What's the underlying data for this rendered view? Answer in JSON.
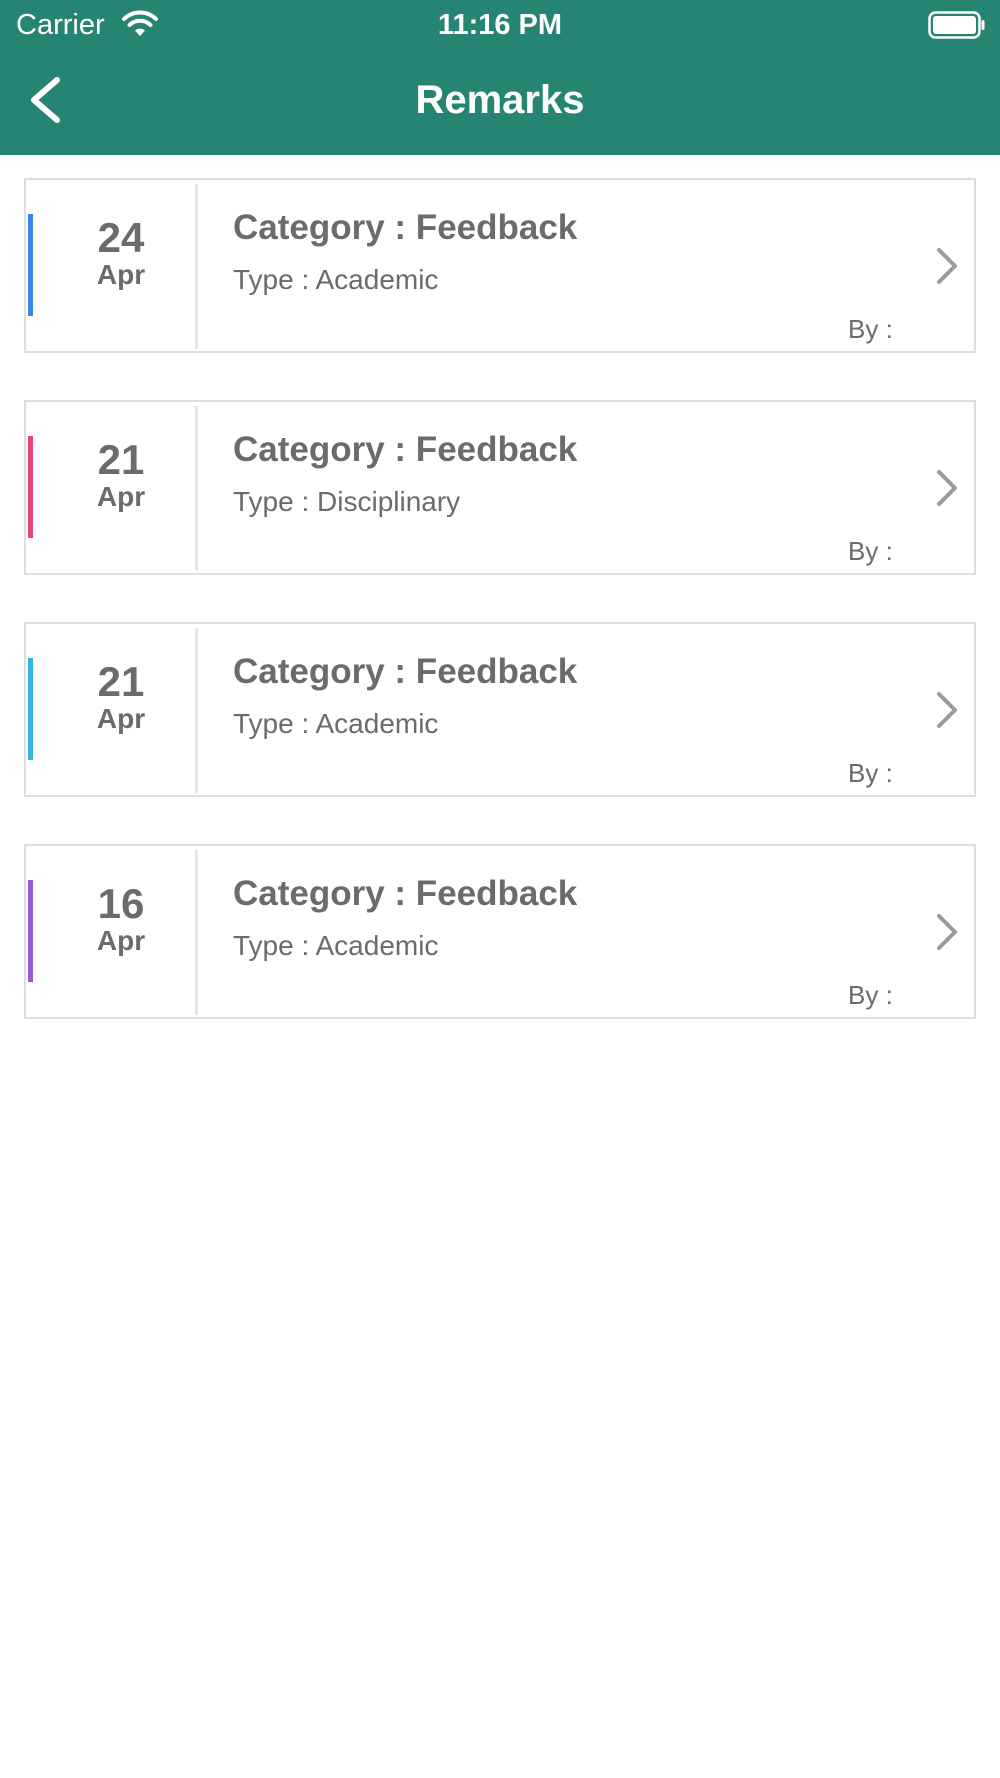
{
  "status_bar": {
    "carrier": "Carrier",
    "time": "11:16 PM",
    "icons": [
      "wifi-icon",
      "battery-icon"
    ]
  },
  "nav": {
    "title": "Remarks",
    "back_icon": "chevron-left-icon"
  },
  "colors": {
    "header": "#268472",
    "text": "#6b6b6b",
    "accents": [
      "#3a86e8",
      "#e8447c",
      "#33b6e0",
      "#9a59dc"
    ]
  },
  "remarks": [
    {
      "day": "24",
      "month": "Apr",
      "category": "Category : Feedback",
      "type": "Type : Academic",
      "by": "By :"
    },
    {
      "day": "21",
      "month": "Apr",
      "category": "Category : Feedback",
      "type": "Type : Disciplinary",
      "by": "By :"
    },
    {
      "day": "21",
      "month": "Apr",
      "category": "Category : Feedback",
      "type": "Type : Academic",
      "by": "By :"
    },
    {
      "day": "16",
      "month": "Apr",
      "category": "Category : Feedback",
      "type": "Type : Academic",
      "by": "By :"
    }
  ]
}
